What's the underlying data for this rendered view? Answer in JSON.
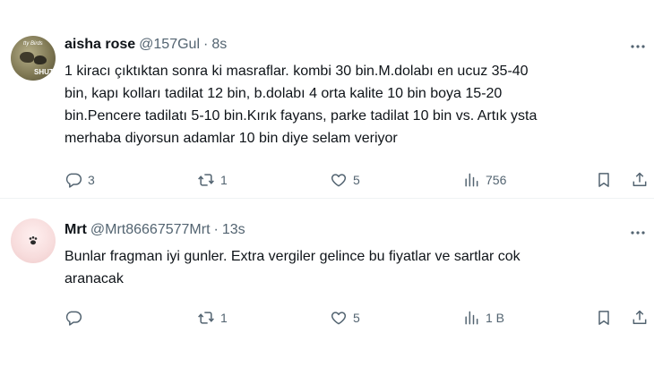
{
  "tweets": [
    {
      "name": "aisha rose",
      "handle": "@157Gul",
      "separator": "·",
      "time": "8s",
      "avatar_badge": "SHUT",
      "avatar_tag": "tty Birds",
      "text": "1 kiracı çıktıktan sonra ki masraflar. kombi 30 bin.M.dolabı en ucuz 35-40\nbin, kapı kolları tadilat 12 bin, b.dolabı 4 orta kalite 10 bin boya 15-20\nbin.Pencere tadilatı 5-10 bin.Kırık fayans, parke tadilat 10 bin vs. Artık ysta\nmerhaba diyorsun adamlar 10 bin diye selam veriyor",
      "replies": "3",
      "retweets": "1",
      "likes": "5",
      "views": "756"
    },
    {
      "name": "Mrt",
      "handle": "@Mrt86667577Mrt",
      "separator": "·",
      "time": "13s",
      "text": "Bunlar fragman iyi gunler. Extra vergiler gelince bu fiyatlar ve sartlar cok\naranacak",
      "replies": "",
      "retweets": "1",
      "likes": "5",
      "views": "1 B"
    }
  ],
  "icons": {
    "reply": "reply-icon",
    "retweet": "retweet-icon",
    "like": "heart-icon",
    "views": "views-icon",
    "bookmark": "bookmark-icon",
    "share": "share-icon",
    "more": "more-icon"
  },
  "colors": {
    "text": "#0f1419",
    "secondary": "#536471",
    "divider": "#eff3f4"
  }
}
